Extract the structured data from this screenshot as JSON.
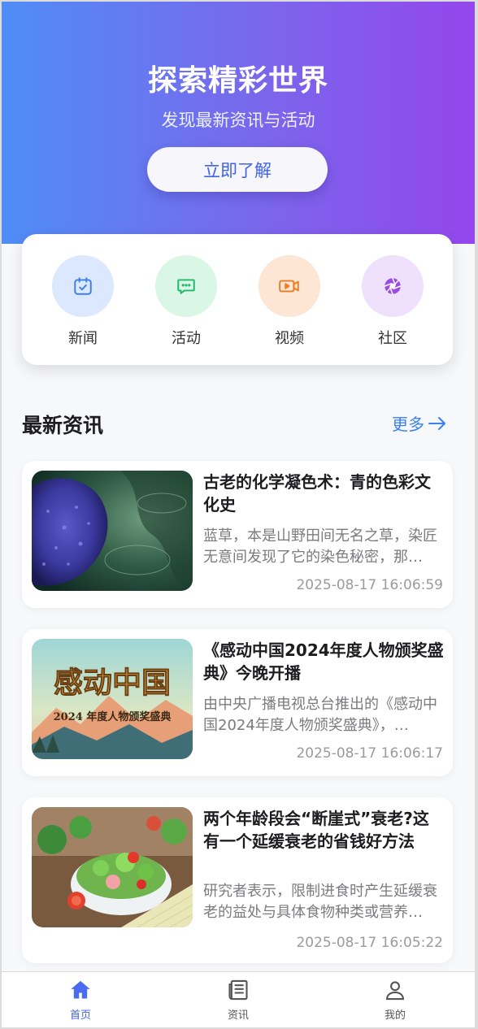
{
  "hero": {
    "title": "探索精彩世界",
    "subtitle": "发现最新资讯与活动",
    "button_label": "立即了解",
    "gradient_start": "#4f8df7",
    "gradient_end": "#9446ec"
  },
  "categories": [
    {
      "label": "新闻",
      "icon": "calendar-check-icon",
      "bg": "#dbe8fd",
      "color": "#3b7ff0"
    },
    {
      "label": "活动",
      "icon": "chat-bubble-icon",
      "bg": "#d9f6e6",
      "color": "#22b86a"
    },
    {
      "label": "视频",
      "icon": "video-camera-icon",
      "bg": "#fde6d3",
      "color": "#f07c22"
    },
    {
      "label": "社区",
      "icon": "aperture-icon",
      "bg": "#efe1fd",
      "color": "#9b4be8"
    }
  ],
  "news_section": {
    "title": "最新资讯",
    "more_label": "更多"
  },
  "news": [
    {
      "title": "古老的化学凝色术：青的色彩文化史",
      "desc": "蓝草，本是山野田间无名之草，染匠无意间发现了它的染色秘密，那…",
      "time": "2025-08-17 16:06:59",
      "image": "indigo-dye-photo"
    },
    {
      "title": "《感动中国2024年度人物颁奖盛典》今晚开播",
      "desc": "由中央广播电视总台推出的《感动中国2024年度人物颁奖盛典》，…",
      "time": "2025-08-17 16:06:17",
      "image": "ceremony-poster",
      "poster_title": "感动中国",
      "poster_sub": "2024 年度人物颁奖盛典"
    },
    {
      "title": "两个年龄段会“断崖式”衰老?这有一个延缓衰老的省钱好方法",
      "desc": "研究者表示，限制进食时产生延缓衰老的益处与具体食物种类或营养…",
      "time": "2025-08-17 16:05:22",
      "image": "salad-photo"
    }
  ],
  "tabbar": [
    {
      "label": "首页",
      "icon": "home-icon",
      "active": true
    },
    {
      "label": "资讯",
      "icon": "news-list-icon",
      "active": false
    },
    {
      "label": "我的",
      "icon": "user-icon",
      "active": false
    }
  ],
  "colors": {
    "accent": "#3b7ff0",
    "tab_active": "#3f63e6",
    "tab_inactive": "#555555"
  }
}
